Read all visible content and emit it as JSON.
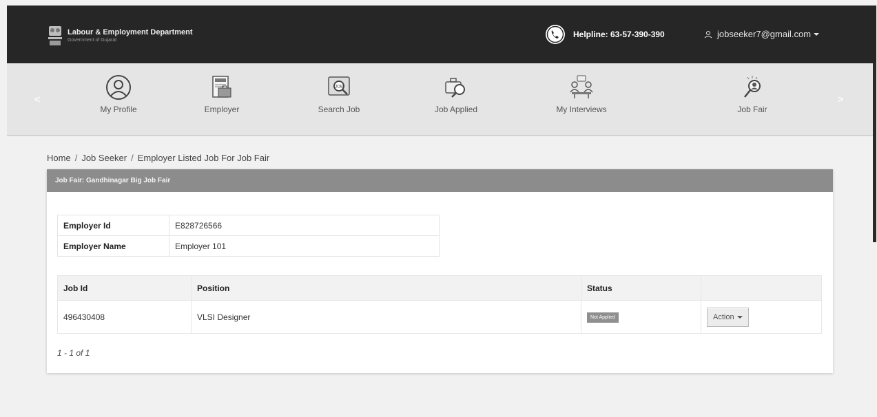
{
  "header": {
    "title": "Labour & Employment Department",
    "subtitle": "Government of Gujarat",
    "helpline": "Helpline: 63-57-390-390",
    "user_email": "jobseeker7@gmail.com"
  },
  "nav": {
    "prev": "<",
    "next": ">",
    "items": [
      {
        "label": "My Profile",
        "icon": "user-circle-icon"
      },
      {
        "label": "Employer",
        "icon": "employer-icon"
      },
      {
        "label": "Search Job",
        "icon": "search-job-icon"
      },
      {
        "label": "Job Applied",
        "icon": "briefcase-search-icon"
      },
      {
        "label": "My Interviews",
        "icon": "interview-icon"
      },
      {
        "label": "Job Fair",
        "icon": "job-fair-icon"
      }
    ]
  },
  "breadcrumb": [
    "Home",
    "Job Seeker",
    "Employer Listed Job For Job Fair"
  ],
  "card": {
    "header": "Job Fair: Gandhinagar Big Job Fair",
    "employer": {
      "id_label": "Employer Id",
      "id_value": "E828726566",
      "name_label": "Employer Name",
      "name_value": "Employer 101"
    },
    "jobs": {
      "headers": [
        "Job Id",
        "Position",
        "Status",
        ""
      ],
      "rows": [
        {
          "job_id": "496430408",
          "position": "VLSI Designer",
          "status": "Not Applied",
          "action": "Action"
        }
      ]
    },
    "pagination": "1 - 1 of 1"
  },
  "colors": {
    "topbar": "#262626",
    "menubar": "#e5e5e5",
    "card_header": "#8c8c8c",
    "badge": "#8f8f8f"
  }
}
